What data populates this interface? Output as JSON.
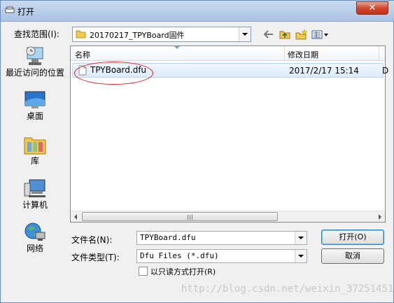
{
  "window": {
    "title": "打开",
    "close_label": "✕"
  },
  "lookin": {
    "label": "查找范围(I):",
    "value": "20170217_TPYBoard固件"
  },
  "toolbar": {
    "back_icon": "back-arrow-icon",
    "up_icon": "up-folder-icon",
    "new_icon": "new-folder-icon",
    "view_icon": "view-menu-icon"
  },
  "places": [
    {
      "label": "最近访问的位置",
      "icon": "recent-places-icon"
    },
    {
      "label": "桌面",
      "icon": "desktop-icon"
    },
    {
      "label": "库",
      "icon": "libraries-icon"
    },
    {
      "label": "计算机",
      "icon": "computer-icon"
    },
    {
      "label": "网络",
      "icon": "network-icon"
    }
  ],
  "filelist": {
    "columns": [
      "名称",
      "修改日期"
    ],
    "rows": [
      {
        "name": "TPYBoard.dfu",
        "date": "2017/2/17 15:14",
        "more": "D"
      }
    ]
  },
  "filename": {
    "label": "文件名(N):",
    "value": "TPYBoard.dfu"
  },
  "filetype": {
    "label": "文件类型(T):",
    "value": "Dfu Files (*.dfu)"
  },
  "readonly": {
    "label": "以只读方式打开(R)"
  },
  "buttons": {
    "open": "打开(O)",
    "cancel": "取消"
  },
  "watermark": "http://blog.csdn.net/weixin_37251451",
  "colors": {
    "title_start": "#c9dbf0",
    "close_red": "#c0361b",
    "selection": "#dcebfc",
    "annotation": "#dd2222"
  }
}
